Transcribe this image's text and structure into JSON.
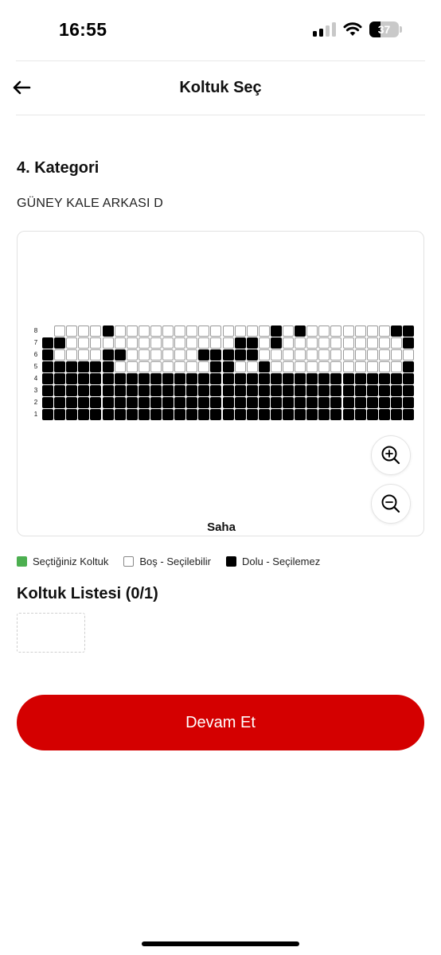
{
  "status_bar": {
    "time": "16:55",
    "battery_level": "37",
    "battery_fraction": 0.37,
    "signal_bars_filled": 2,
    "signal_bars_total": 4
  },
  "header": {
    "title": "Koltuk Seç",
    "back_icon": "arrow-left-icon"
  },
  "category": {
    "title": "4. Kategori",
    "block_name": "GÜNEY KALE ARKASI D"
  },
  "seat_map": {
    "row_labels": [
      "8",
      "7",
      "6",
      "5",
      "4",
      "3",
      "2",
      "1"
    ],
    "columns": 31,
    "rows": [
      "0000050000000000000505000000055",
      "5500000000000000550500000000005",
      "5000055000000555550000000000000",
      "5555550000000055005000000000005",
      "5555555555555555555555555555555",
      "5555555555555555555555555555555",
      "5555555555555555555555555555555",
      "5555555555555555555555555555555"
    ],
    "row_offsets": [
      1,
      0,
      0,
      0,
      0,
      0,
      0,
      0
    ],
    "field_label": "Saha",
    "zoom_in_icon": "zoom-in-icon",
    "zoom_out_icon": "zoom-out-icon"
  },
  "legend": {
    "selected": "Seçtiğiniz Koltuk",
    "available": "Boş - Seçilebilir",
    "occupied": "Dolu - Seçilemez",
    "colors": {
      "selected": "#4caf50",
      "available": "#ffffff",
      "occupied": "#000000"
    }
  },
  "seat_list": {
    "title": "Koltuk Listesi (0/1)"
  },
  "actions": {
    "continue_label": "Devam Et",
    "accent": "#d40000"
  }
}
